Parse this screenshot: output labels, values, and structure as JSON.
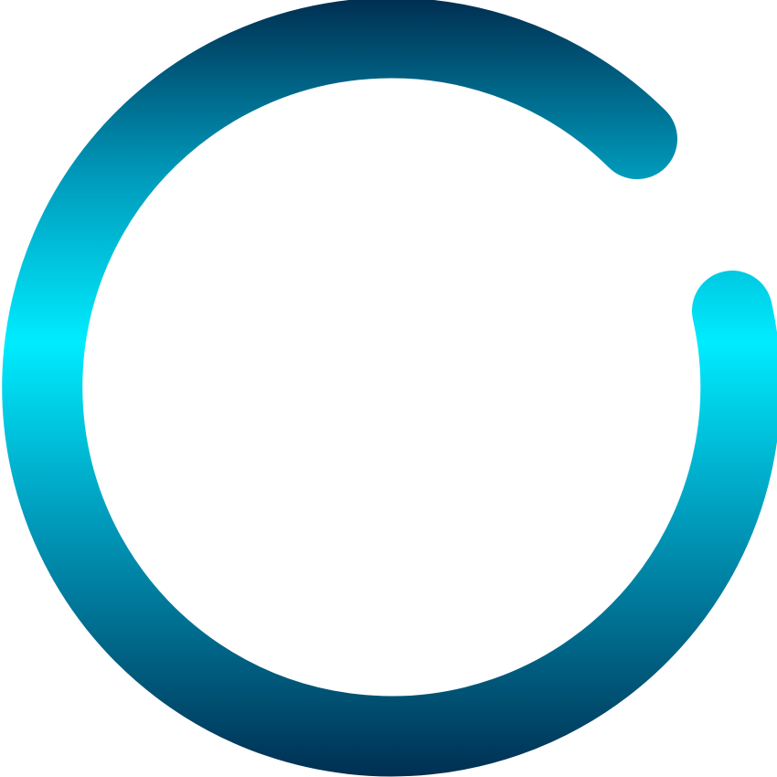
{
  "graphic": {
    "icon": "open-ring-loading-spinner",
    "colors": {
      "background": "#ffffff",
      "gradient_dark": "#002f52",
      "gradient_mid": "#0097b8",
      "gradient_bright": "#00ecff"
    }
  }
}
